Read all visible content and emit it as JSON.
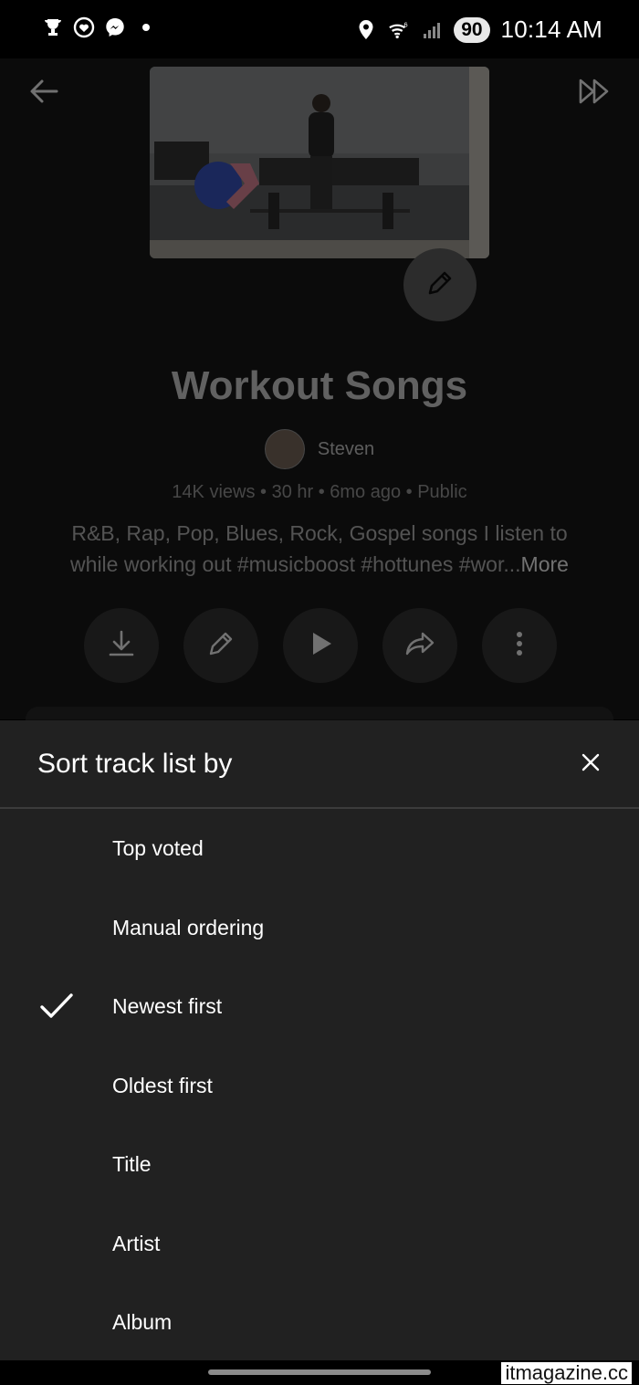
{
  "status_bar": {
    "time": "10:14 AM",
    "battery": "90",
    "left_icons": [
      "trophy-icon",
      "heart-badge-icon",
      "messenger-icon",
      "dot-icon"
    ],
    "right_icons": [
      "location-icon",
      "wifi-icon",
      "signal-icon"
    ]
  },
  "playlist": {
    "title": "Workout Songs",
    "owner": "Steven",
    "meta": "14K views • 30 hr • 6mo ago • Public",
    "description": "R&B, Rap, Pop, Blues, Rock, Gospel songs I listen to while working out #musicboost #hottunes #wor...",
    "more_label": "More",
    "actions": [
      "download-button",
      "edit-button",
      "play-button",
      "share-button",
      "more-options-button"
    ]
  },
  "sort_sheet": {
    "title": "Sort track list by",
    "selected": "Newest first",
    "options": [
      "Top voted",
      "Manual ordering",
      "Newest first",
      "Oldest first",
      "Title",
      "Artist",
      "Album"
    ]
  },
  "watermark": "itmagazine.cc",
  "colors": {
    "sheet_bg": "#212121",
    "page_bg": "#000000",
    "divider": "#3c3c3c"
  }
}
